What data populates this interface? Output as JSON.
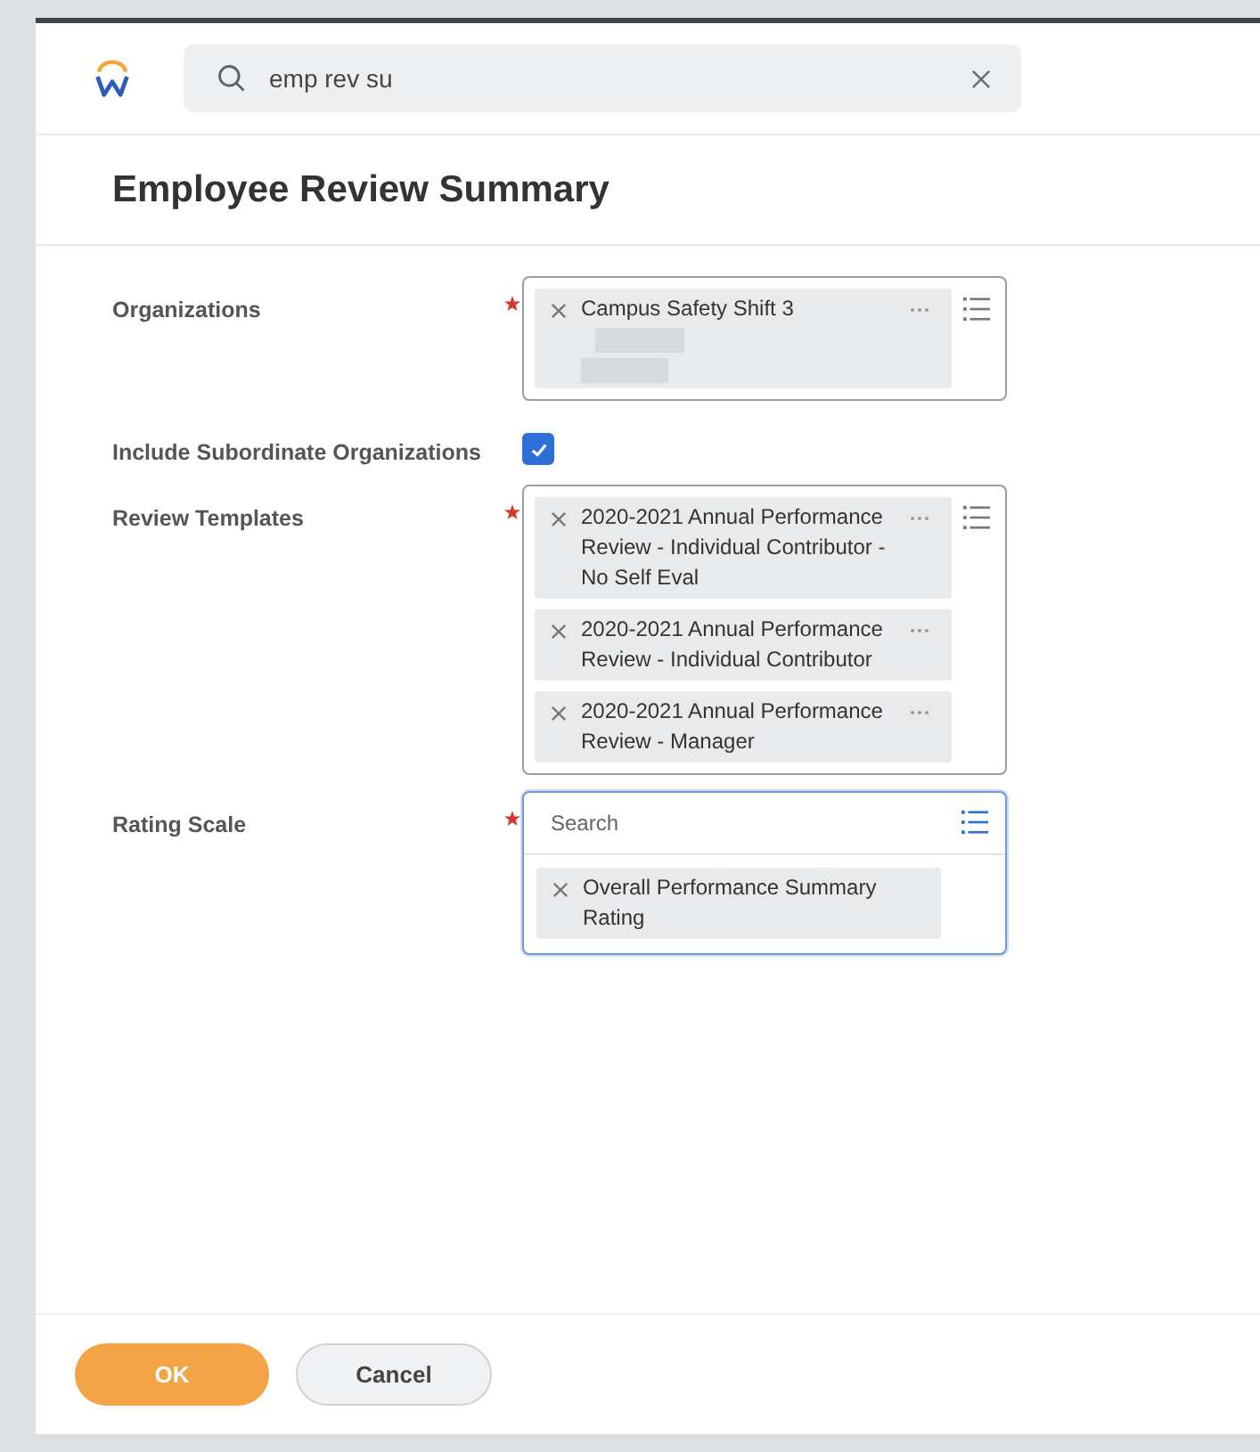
{
  "search": {
    "value": "emp rev su"
  },
  "page_title": "Employee Review Summary",
  "fields": [
    {
      "kind": "multiselect",
      "label": "Organizations",
      "required": true,
      "items": [
        {
          "text": "Campus Safety Shift 3",
          "redacted": true
        }
      ]
    },
    {
      "kind": "checkbox",
      "label": "Include Subordinate Organizations",
      "checked": true
    },
    {
      "kind": "multiselect",
      "label": "Review Templates",
      "required": true,
      "items": [
        {
          "text": "2020-2021 Annual Performance Review - Individual Contributor - No Self Eval",
          "redacted": false
        },
        {
          "text": "2020-2021 Annual Performance Review - Individual Contributor",
          "redacted": false
        },
        {
          "text": "2020-2021 Annual Performance Review - Manager",
          "redacted": false
        }
      ]
    },
    {
      "kind": "search_select",
      "label": "Rating Scale",
      "required": true,
      "placeholder": "Search",
      "focused": true,
      "items": [
        {
          "text": "Overall Performance Summary Rating",
          "redacted": false
        }
      ]
    }
  ],
  "buttons": [
    {
      "label": "OK",
      "kind": "primary"
    },
    {
      "label": "Cancel",
      "kind": "secondary"
    }
  ]
}
